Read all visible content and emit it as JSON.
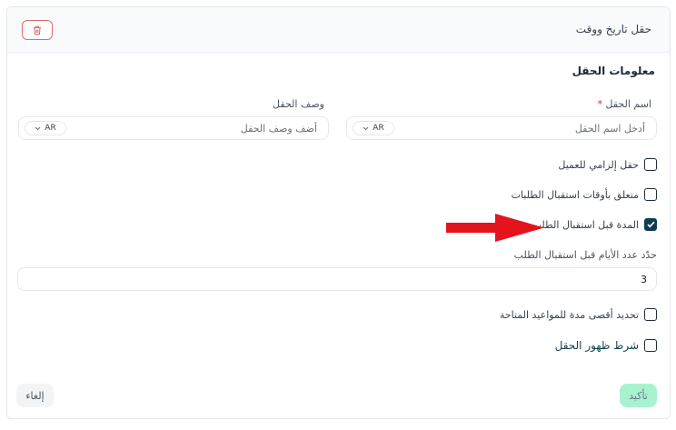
{
  "header": {
    "title": "حقل تاريخ ووقت",
    "delete_icon": "trash-icon"
  },
  "section_title": "معلومات الحقل",
  "field_name": {
    "label": "اسم الحقل",
    "required_mark": "*",
    "placeholder": "أدخل اسم الحقل",
    "lang": "AR"
  },
  "field_description": {
    "label": "وصف الحقل",
    "placeholder": "أضف وصف الحقل",
    "lang": "AR"
  },
  "checkboxes": {
    "required_field": {
      "label": "حقل إلزامي للعميل",
      "checked": false
    },
    "request_times": {
      "label": "متعلق بأوقات استقبال الطلبات",
      "checked": false
    },
    "duration_before": {
      "label": "المدة قبل استقبال الطلب",
      "checked": true
    },
    "max_duration": {
      "label": "تحديد أقصى مدة للمواعيد المتاحة",
      "checked": false
    },
    "visibility_condition": {
      "label": "شرط ظهور الحقل",
      "checked": false
    }
  },
  "days_input": {
    "label": "حدّد عدد الأيام قبل استقبال الطلب",
    "value": "3"
  },
  "footer": {
    "confirm_label": "تأكيد",
    "cancel_label": "إلغاء"
  },
  "colors": {
    "accent": "#0f3d4f",
    "confirm_bg": "#a7f3d0",
    "danger": "#e26a6a",
    "arrow": "#e3141b"
  }
}
